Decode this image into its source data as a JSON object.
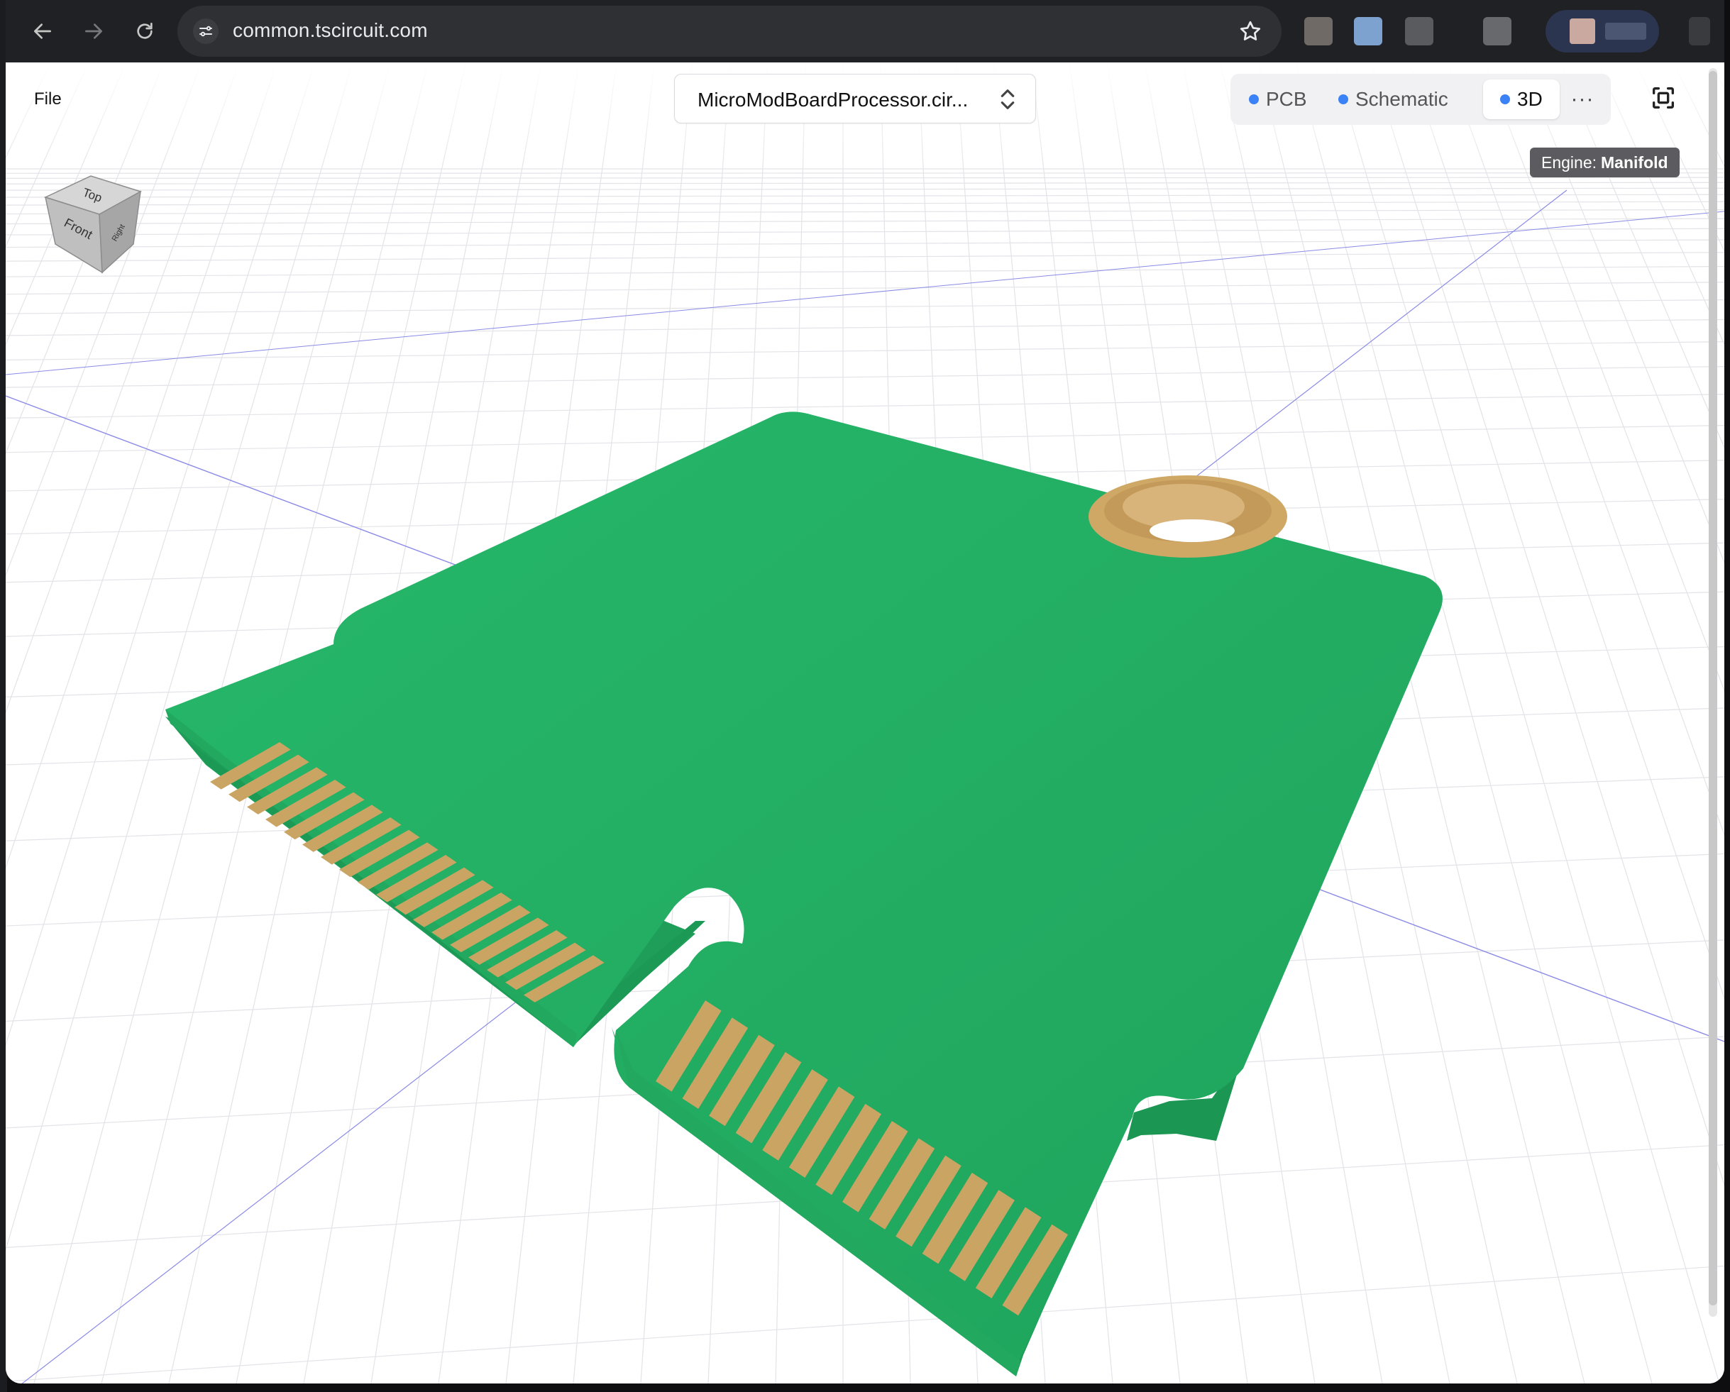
{
  "browser": {
    "url": "common.tscircuit.com"
  },
  "app": {
    "menu_file": "File",
    "file_selector": "MicroModBoardProcessor.cir...",
    "tabs": [
      {
        "label": "PCB",
        "active": false
      },
      {
        "label": "Schematic",
        "active": false
      },
      {
        "label": "3D",
        "active": true
      }
    ],
    "more_label": "···",
    "engine_label": "Engine:",
    "engine_value": "Manifold"
  },
  "viewcube": {
    "top": "Top",
    "front": "Front",
    "right": "Right"
  },
  "colors": {
    "pcb": "#22ad62",
    "pcb_edge": "#1d9a57",
    "gold": "#c9a463",
    "grid": "#e3e3e8",
    "axis": "#8a8ae6",
    "tab_dot": "#3b82f6"
  },
  "icons": {
    "back": "arrow-left-icon",
    "forward": "arrow-right-icon",
    "reload": "reload-icon",
    "site_settings": "tune-icon",
    "bookmark": "star-icon",
    "fullscreen": "fullscreen-icon",
    "chevron": "chevron-up-down-icon"
  }
}
